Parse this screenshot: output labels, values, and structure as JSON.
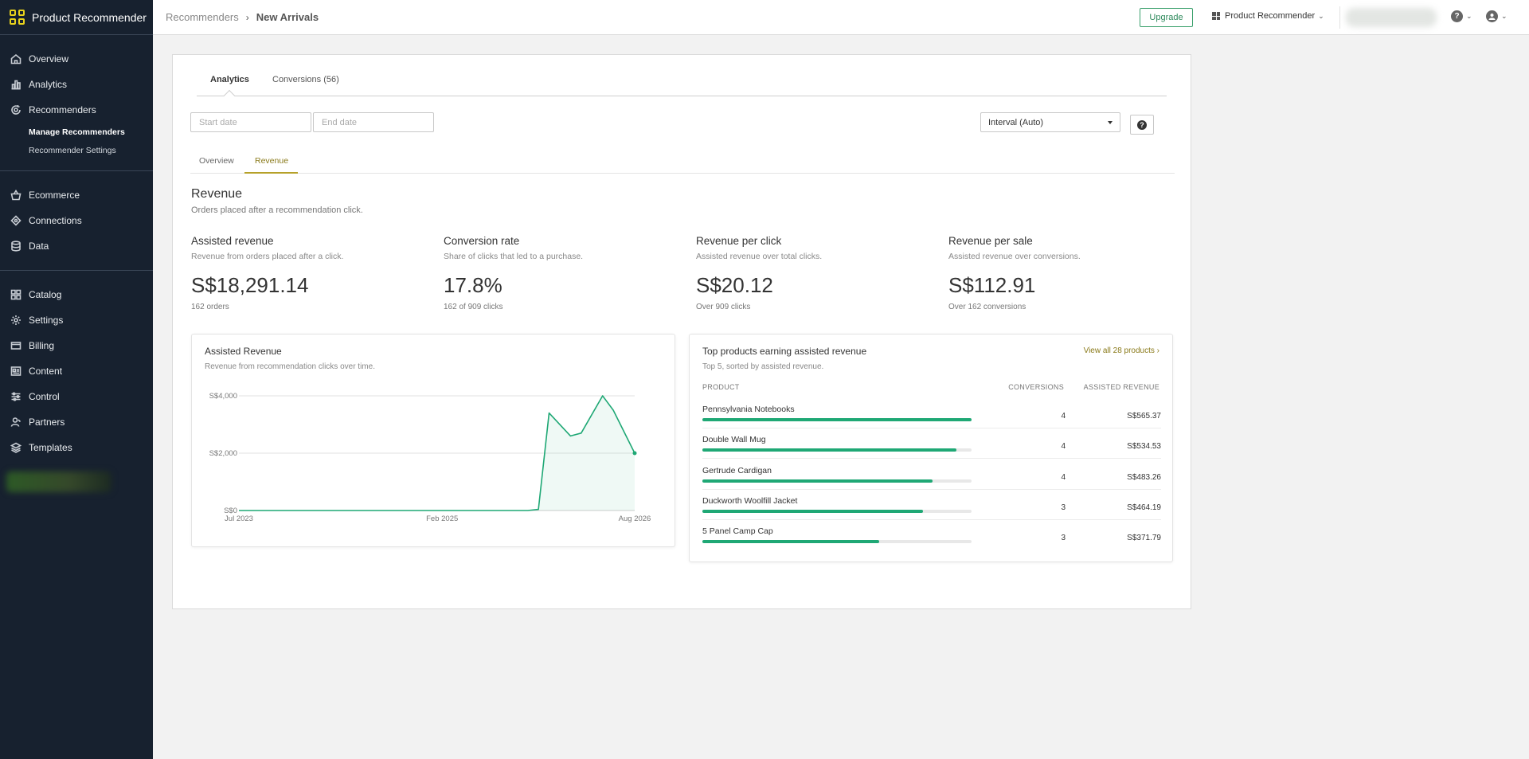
{
  "app": {
    "name": "Product Recommender"
  },
  "sidebar": {
    "groups": [
      [
        {
          "label": "Overview",
          "icon": "home-icon"
        },
        {
          "label": "Analytics",
          "icon": "bar-chart-icon"
        },
        {
          "label": "Recommenders",
          "icon": "recommenders-icon"
        }
      ],
      [
        {
          "label": "Ecommerce",
          "icon": "basket-icon"
        },
        {
          "label": "Connections",
          "icon": "connections-icon"
        },
        {
          "label": "Data",
          "icon": "database-icon"
        }
      ],
      [
        {
          "label": "Catalog",
          "icon": "grid-icon"
        },
        {
          "label": "Settings",
          "icon": "gear-icon"
        },
        {
          "label": "Billing",
          "icon": "card-icon"
        },
        {
          "label": "Content",
          "icon": "content-icon"
        },
        {
          "label": "Control",
          "icon": "sliders-icon"
        },
        {
          "label": "Partners",
          "icon": "users-icon"
        },
        {
          "label": "Templates",
          "icon": "layers-icon"
        }
      ]
    ],
    "subitems": [
      "Manage Recommenders",
      "Recommender Settings"
    ]
  },
  "topbar": {
    "breadcrumb_parent": "Recommenders",
    "breadcrumb_sep": "›",
    "breadcrumb_current": "New Arrivals",
    "upgrade": "Upgrade",
    "app_switch": "Product Recommender",
    "help_glyph": "?",
    "chevron": "⌄"
  },
  "tabs": {
    "analytics": "Analytics",
    "conversions": "Conversions (56)"
  },
  "filters": {
    "start_placeholder": "Start date",
    "end_placeholder": "End date",
    "interval": "Interval (Auto)",
    "help_glyph": "?"
  },
  "subtabs": {
    "overview": "Overview",
    "revenue": "Revenue"
  },
  "section": {
    "title": "Revenue",
    "subtitle": "Orders placed after a recommendation click."
  },
  "kpis": [
    {
      "label": "Assisted revenue",
      "desc": "Revenue from orders placed after a click.",
      "value": "S$18,291.14",
      "foot": "162 orders"
    },
    {
      "label": "Conversion rate",
      "desc": "Share of clicks that led to a purchase.",
      "value": "17.8%",
      "foot": "162 of 909 clicks"
    },
    {
      "label": "Revenue per click",
      "desc": "Assisted revenue over total clicks.",
      "value": "S$20.12",
      "foot": "Over 909 clicks"
    },
    {
      "label": "Revenue per sale",
      "desc": "Assisted revenue over conversions.",
      "value": "S$112.91",
      "foot": "Over 162 conversions"
    }
  ],
  "chart_card": {
    "title": "Assisted Revenue",
    "subtitle": "Revenue from recommendation clicks over time."
  },
  "chart_data": {
    "type": "area",
    "title": "Assisted Revenue",
    "xlabel": "",
    "ylabel": "",
    "x_tick_labels": [
      "Jul 2023",
      "Feb 2025",
      "Aug 2026"
    ],
    "y_tick_labels": [
      "S$4,000",
      "S$2,000",
      "S$0"
    ],
    "y_ticks": [
      4000,
      2000,
      0
    ],
    "ylim": [
      0,
      4000
    ],
    "x_domain": [
      "2023-07",
      "2026-08"
    ],
    "x_tick_values": [
      "2023-07",
      "2025-02",
      "2026-08"
    ],
    "grid": true,
    "color": "#1fa875",
    "points": [
      {
        "x": "2023-07",
        "y": 0
      },
      {
        "x": "2024-01",
        "y": 0
      },
      {
        "x": "2024-07",
        "y": 0
      },
      {
        "x": "2025-01",
        "y": 0
      },
      {
        "x": "2025-07",
        "y": 0
      },
      {
        "x": "2025-10",
        "y": 0
      },
      {
        "x": "2025-11",
        "y": 40
      },
      {
        "x": "2025-12",
        "y": 3400
      },
      {
        "x": "2026-02",
        "y": 2600
      },
      {
        "x": "2026-03",
        "y": 2700
      },
      {
        "x": "2026-05",
        "y": 4000
      },
      {
        "x": "2026-06",
        "y": 3500
      },
      {
        "x": "2026-08",
        "y": 2000
      }
    ]
  },
  "products_card": {
    "title": "Top products earning assisted revenue",
    "subtitle": "Top 5, sorted by assisted revenue.",
    "view_all": "View all 28 products ›",
    "col_product": "PRODUCT",
    "col_conversions": "CONVERSIONS",
    "col_revenue": "ASSISTED REVENUE",
    "rows": [
      {
        "name": "Pennsylvania Notebooks",
        "conversions": "4",
        "revenue": "S$565.37",
        "share": 1.0
      },
      {
        "name": "Double Wall Mug",
        "conversions": "4",
        "revenue": "S$534.53",
        "share": 0.945
      },
      {
        "name": "Gertrude Cardigan",
        "conversions": "4",
        "revenue": "S$483.26",
        "share": 0.855
      },
      {
        "name": "Duckworth Woolfill Jacket",
        "conversions": "3",
        "revenue": "S$464.19",
        "share": 0.821
      },
      {
        "name": "5 Panel Camp Cap",
        "conversions": "3",
        "revenue": "S$371.79",
        "share": 0.658
      }
    ]
  }
}
